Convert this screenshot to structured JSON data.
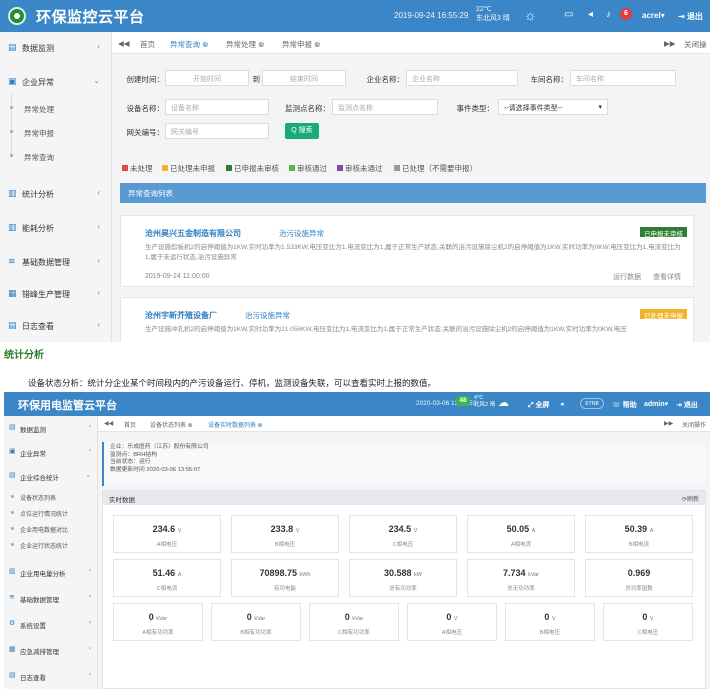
{
  "shot1": {
    "header": {
      "title": "环保监控云平台",
      "datetime": "2019-09-24  16:55:29",
      "temp": "22℃",
      "wind": "东北风3  晴",
      "badge": "6",
      "user": "acrel",
      "logout": "退出"
    },
    "sidebar": {
      "items": [
        {
          "label": "数据监测",
          "icon": "monitor-icon"
        },
        {
          "label": "企业异常",
          "icon": "report-icon"
        },
        {
          "label": "统计分析",
          "icon": "bar-chart-icon"
        },
        {
          "label": "能耗分析",
          "icon": "bar-chart-icon"
        },
        {
          "label": "基础数据管理",
          "icon": "database-icon"
        },
        {
          "label": "错峰生产管理",
          "icon": "calendar-icon"
        },
        {
          "label": "日志查看",
          "icon": "log-icon"
        }
      ],
      "subitems": [
        "异常处理",
        "异常申报",
        "异常查询"
      ]
    },
    "tabs": {
      "back": "◀◀",
      "home": "首页",
      "t1": "异常查询",
      "t2": "异常处理",
      "t3": "异常申报",
      "forward": "▶▶",
      "close": "关闭操"
    },
    "filters": {
      "create_time": "创建时间：",
      "start_ph": "开始时间",
      "to": "到",
      "end_ph": "结束时间",
      "company_lbl": "企业名称：",
      "company_ph": "企业名称",
      "workshop_lbl": "车间名称：",
      "workshop_ph": "车间名称",
      "device_lbl": "设备名称：",
      "device_ph": "设备名称",
      "monitor_lbl": "监测点名称：",
      "monitor_ph": "监测点名称",
      "event_lbl": "事件类型：",
      "event_val": "--请选择事件类型--",
      "gateway_lbl": "网关编号：",
      "gateway_ph": "网关编号",
      "search": "Q 搜索"
    },
    "legend": [
      {
        "label": "未处理",
        "color": "#e04848"
      },
      {
        "label": "已处理未申报",
        "color": "#f0b429"
      },
      {
        "label": "已申报未审核",
        "color": "#2e7d32"
      },
      {
        "label": "审核通过",
        "color": "#57b947"
      },
      {
        "label": "审核未通过",
        "color": "#8e44ad"
      },
      {
        "label": "已处理（不需要申报）",
        "color": "#999999"
      }
    ],
    "list_title": "异常查询列表",
    "cards": [
      {
        "company": "沧州昊兴五金制造有限公司",
        "type": "治污设施异常",
        "tag": "已申报未审核",
        "tag_color": "#2e7d32",
        "desc": "生产设施剪板机2的启停阈值为1KW,实时功率为1.533KW,电压变比为1,电流变比为1,属于正常生产状态;关联的治污设施除尘机2的启停阈值为1KW,实时功率为0KW,电压变比为1,电流变比为1,属于未运行状态,治污设施异常",
        "time": "2019-09-24 11:00:00",
        "a1": "运行数据",
        "a2": "查看详情"
      },
      {
        "company": "沧州宇新芥殖设备厂",
        "type": "治污设施异常",
        "tag": "已处理未申报",
        "tag_color": "#f0b429",
        "desc": "生产设施冲孔机2的启停阈值为1KW,实时功率为21.056KW,电压变比为1,电流变比为1,属于正常生产状态;关联的治污设施除尘机2的启停阈值为1KW,实时功率为0KW,电压"
      }
    ]
  },
  "caption": {
    "heading": "统计分析",
    "body": "设备状态分析：统计分企业某个时间段内的产污设备运行、停机，监测设备失联，可以查看实时上报的数值。"
  },
  "shot2": {
    "header": {
      "title": "环保用电监管云平台",
      "datetime": "2020-03-06  13:55:53",
      "aqi": "48",
      "temp": "4℃",
      "wind": "北风2  晴",
      "fullscreen": "全屏",
      "pill": "6TN8",
      "help": "帮助",
      "user": "admin",
      "logout": "退出"
    },
    "sidebar": {
      "items": [
        {
          "label": "数据监测",
          "icon": "monitor-icon"
        },
        {
          "label": "企业异常",
          "icon": "report-icon"
        },
        {
          "label": "企业综合统计",
          "icon": "monitor-icon"
        },
        {
          "label": "企业用电量分析",
          "icon": "bar-chart-icon"
        },
        {
          "label": "基础数据管理",
          "icon": "database-icon"
        },
        {
          "label": "系统设置",
          "icon": "gear-icon"
        },
        {
          "label": "应急减排管理",
          "icon": "calendar-icon"
        },
        {
          "label": "日志查看",
          "icon": "log-icon"
        }
      ],
      "subitems": [
        "设备状态列表",
        "点位运行情况统计",
        "企业用电数据对比",
        "企业运行状态统计"
      ]
    },
    "tabs": {
      "back": "◀◀",
      "home": "首页",
      "t1": "设备状态列表",
      "t2": "设备实时数据列表",
      "forward": "▶▶",
      "close": "关闭操作"
    },
    "info": {
      "l1": "企业：乐成医药（江苏）股份有限公司",
      "l2": "监测点：BRH结构",
      "l3": "当前状态：运行",
      "l4": "数据更新时间 2020-03-06 13:55:07"
    },
    "panel_title": "实时数据",
    "refresh": "刷新",
    "metrics_row1": [
      {
        "value": "234.6",
        "unit": "V",
        "label": "A相电压"
      },
      {
        "value": "233.8",
        "unit": "V",
        "label": "B相电压"
      },
      {
        "value": "234.5",
        "unit": "V",
        "label": "C相电压"
      },
      {
        "value": "50.05",
        "unit": "A",
        "label": "A相电流"
      },
      {
        "value": "50.39",
        "unit": "A",
        "label": "B相电流"
      }
    ],
    "metrics_row2": [
      {
        "value": "51.46",
        "unit": "A",
        "label": "C相电流"
      },
      {
        "value": "70898.75",
        "unit": "kWh",
        "label": "有功电能"
      },
      {
        "value": "30.588",
        "unit": "kW",
        "label": "总有功功率"
      },
      {
        "value": "7.734",
        "unit": "kVar",
        "label": "总无功功率"
      },
      {
        "value": "0.969",
        "unit": "",
        "label": "总功率因数"
      }
    ],
    "metrics_row3": [
      {
        "value": "0",
        "unit": "kVar",
        "label": "A相有功功率"
      },
      {
        "value": "0",
        "unit": "kVar",
        "label": "B相有功功率"
      },
      {
        "value": "0",
        "unit": "kVar",
        "label": "C相有功功率"
      },
      {
        "value": "0",
        "unit": "V",
        "label": "A相电压"
      },
      {
        "value": "0",
        "unit": "V",
        "label": "B相电压"
      },
      {
        "value": "0",
        "unit": "V",
        "label": "C相电压"
      }
    ]
  }
}
